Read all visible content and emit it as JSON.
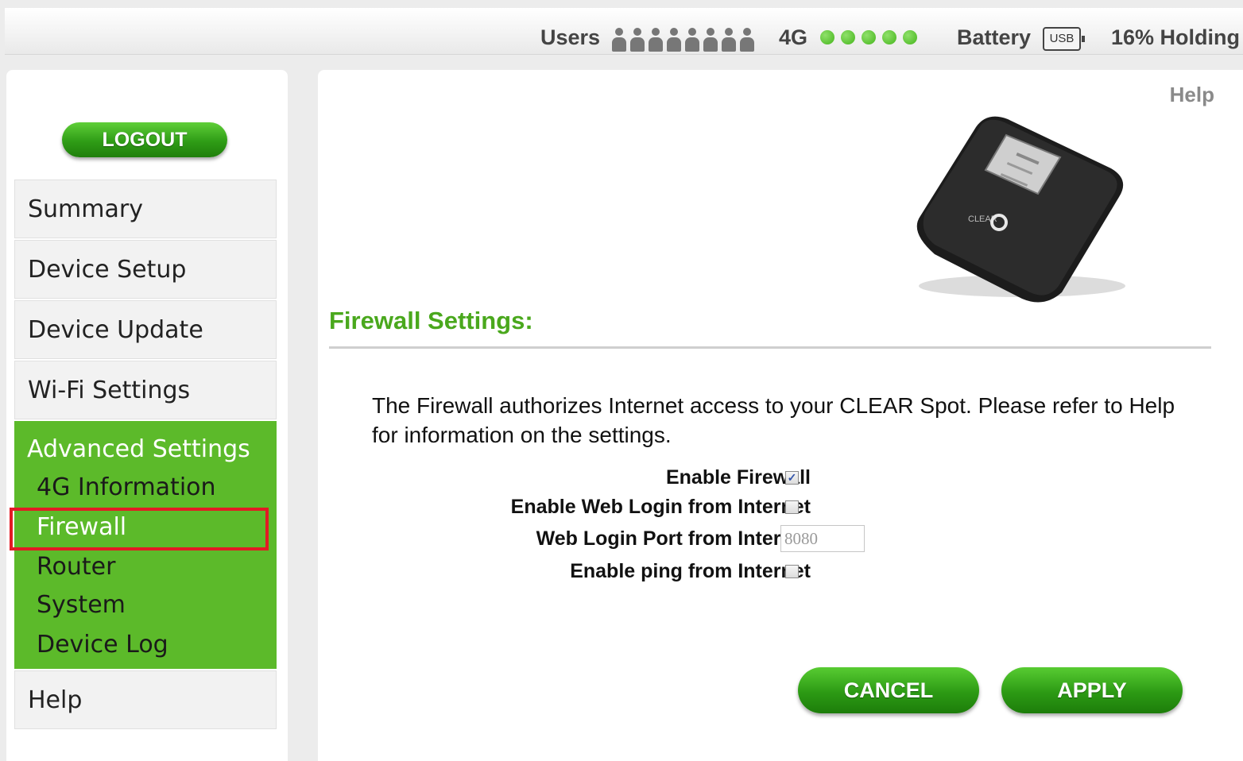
{
  "status_bar": {
    "users_label": "Users",
    "users_count_icons": 9,
    "network_label": "4G",
    "signal_dots": 5,
    "battery_label": "Battery",
    "usb_label": "USB",
    "battery_status": "16% Holding",
    "signal_color": "#5cc232"
  },
  "sidebar": {
    "logout_label": "LOGOUT",
    "items": [
      {
        "label": "Summary"
      },
      {
        "label": "Device Setup"
      },
      {
        "label": "Device Update"
      },
      {
        "label": "Wi-Fi Settings"
      }
    ],
    "advanced": {
      "title": "Advanced Settings",
      "subitems": [
        {
          "label": "4G Information"
        },
        {
          "label": "Firewall",
          "active": true
        },
        {
          "label": "Router"
        },
        {
          "label": "System"
        },
        {
          "label": "Device Log"
        }
      ]
    },
    "help_label": "Help",
    "accent_color": "#5cba2a",
    "highlight_color": "#e21b24"
  },
  "main": {
    "help_link": "Help",
    "device_image": "clear-spot-device",
    "device_screen_text": "CLEAR",
    "section_title": "Firewall Settings:",
    "description": "The Firewall authorizes Internet access to your CLEAR Spot. Please refer to Help for information on the settings.",
    "fields": {
      "enable_firewall": {
        "label": "Enable Firewall",
        "checked": true
      },
      "enable_web_login": {
        "label": "Enable Web Login from Internet",
        "checked": false
      },
      "web_login_port": {
        "label": "Web Login Port from Internet",
        "value": "8080"
      },
      "enable_ping": {
        "label": "Enable ping from Internet",
        "checked": false
      }
    },
    "cancel_label": "CANCEL",
    "apply_label": "APPLY"
  }
}
